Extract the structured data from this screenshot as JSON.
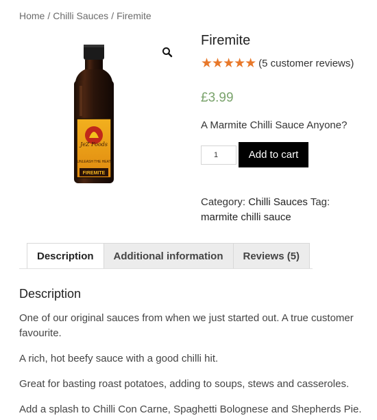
{
  "breadcrumb": {
    "home": "Home",
    "category": "Chilli Sauces",
    "current": "Firemite",
    "separator": "/"
  },
  "product": {
    "title": "Firemite",
    "rating": 5,
    "review_link": "(5 customer reviews)",
    "price": "£3.99",
    "short_description": "A Marmite Chilli Sauce Anyone?",
    "quantity": "1",
    "add_to_cart_label": "Add to cart",
    "category_label": "Category:",
    "category": "Chilli Sauces",
    "tag_label": "Tag:",
    "tag": "marmite chilli sauce",
    "label": {
      "brand": "JeZ Foods",
      "slogan": "UNLEASH THE HEAT",
      "name": "FIREMITE"
    }
  },
  "tabs": [
    {
      "label": "Description",
      "active": true
    },
    {
      "label": "Additional information",
      "active": false
    },
    {
      "label": "Reviews (5)",
      "active": false
    }
  ],
  "description": {
    "heading": "Description",
    "paragraphs": [
      "One of our original sauces from when we just started out. A true customer favourite.",
      "A rich, hot beefy sauce with a good chilli hit.",
      "Great for basting roast potatoes, adding to soups, stews and casseroles.",
      "Add a splash to Chilli Con Carne, Spaghetti Bolognese and Shepherds Pie."
    ]
  },
  "colors": {
    "price": "#7aa36c",
    "stars": "#e8782a",
    "button": "#000000"
  }
}
